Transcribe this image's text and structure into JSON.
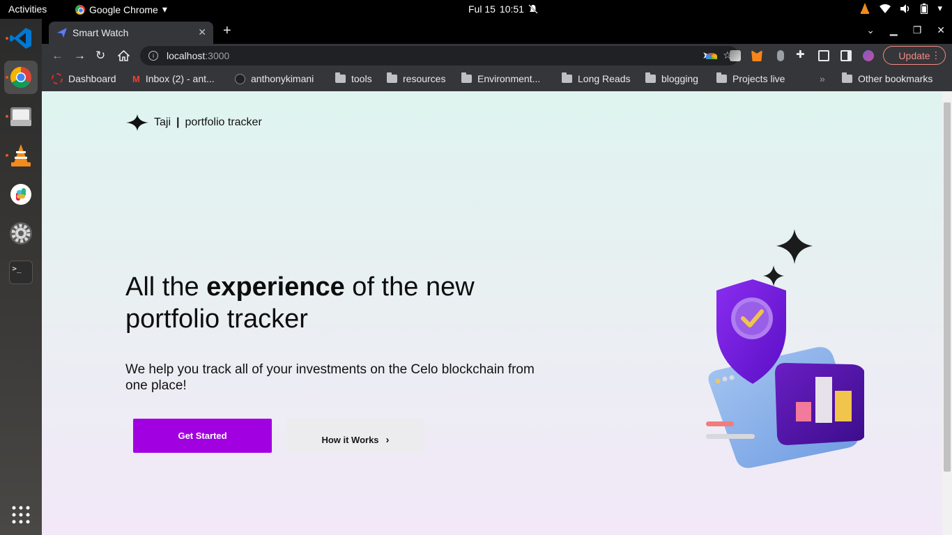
{
  "system_bar": {
    "activities": "Activities",
    "app_name": "Google Chrome",
    "date": "Ful 15",
    "time": "10:51"
  },
  "dock": {
    "items": [
      "vscode-icon",
      "chrome-icon",
      "files-icon",
      "vlc-icon",
      "slack-icon",
      "settings-icon",
      "terminal-icon",
      "app-grid-icon"
    ]
  },
  "browser": {
    "tab_title": "Smart Watch",
    "url_host": "localhost",
    "url_port": ":3000",
    "update_label": "Update",
    "bookmarks": [
      "Dashboard",
      "Inbox (2) - ant...",
      "anthonykimani",
      "tools",
      "resources",
      "Environment...",
      "Long Reads",
      "blogging",
      "Projects live"
    ],
    "overflow": "»",
    "other_bookmarks": "Other bookmarks"
  },
  "page": {
    "brand": "Taji",
    "brand_separator": "|",
    "brand_tagline": "portfolio tracker",
    "hero_title_pre": "All the ",
    "hero_title_bold": "experience",
    "hero_title_post": " of the new portfolio tracker",
    "hero_subtitle": "We help you track all of your investments on the Celo blockchain from one place!",
    "cta_primary": "Get Started",
    "cta_secondary": "How it Works",
    "accent_color": "#a100e0"
  }
}
